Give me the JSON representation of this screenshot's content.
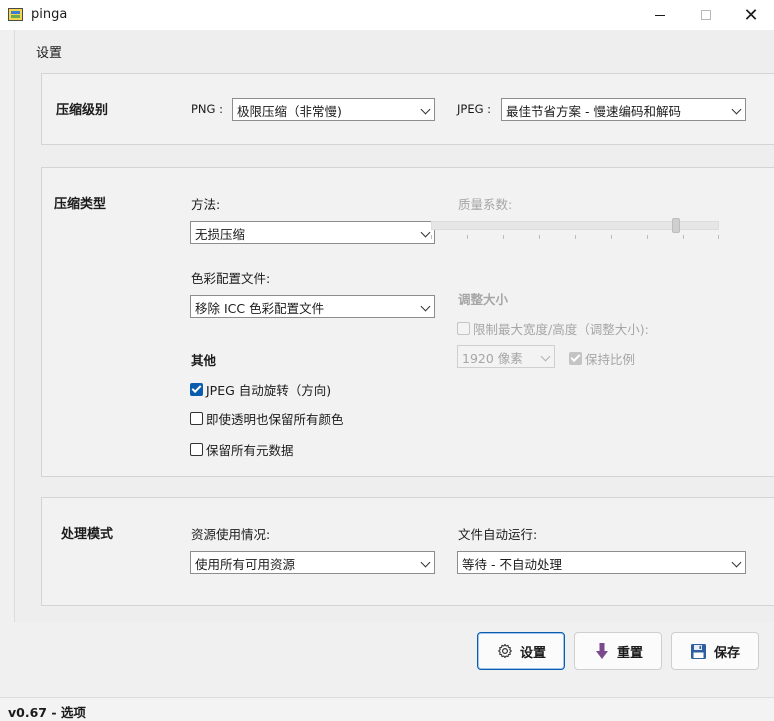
{
  "window": {
    "title": "pinga",
    "minimize_glyph": "",
    "close_glyph": "✕"
  },
  "section_title": "设置",
  "compression_level": {
    "title": "压缩级别",
    "png_label": "PNG :",
    "png_value": "极限压缩（非常慢)",
    "jpeg_label": "JPEG :",
    "jpeg_value": "最佳节省方案 - 慢速编码和解码"
  },
  "compression_type": {
    "title": "压缩类型",
    "method_label": "方法:",
    "method_value": "无损压缩",
    "color_profile_label": "色彩配置文件:",
    "color_profile_value": "移除 ICC 色彩配置文件",
    "other_title": "其他",
    "options": [
      {
        "label": "JPEG 自动旋转（方向)",
        "checked": true
      },
      {
        "label": "即使透明也保留所有颜色",
        "checked": false
      },
      {
        "label": "保留所有元数据",
        "checked": false
      }
    ],
    "quality_label": "质量系数:",
    "quality_level": 0.86,
    "resize_title": "调整大小",
    "limit_label": "限制最大宽度/高度（调整大小):",
    "limit_checked": false,
    "pixels_value": "1920 像素",
    "keep_ratio_label": "保持比例",
    "keep_ratio_checked": true
  },
  "processing": {
    "title": "处理模式",
    "resource_label": "资源使用情况:",
    "resource_value": "使用所有可用资源",
    "autorun_label": "文件自动运行:",
    "autorun_value": "等待 - 不自动处理"
  },
  "buttons": {
    "settings": "设置",
    "reset": "重置",
    "save": "保存"
  },
  "status": "v0.67 - 选项",
  "colors": {
    "accent": "#0b5cad",
    "reset_arrow": "#7a4a8c",
    "save_icon": "#2f5f9e"
  }
}
